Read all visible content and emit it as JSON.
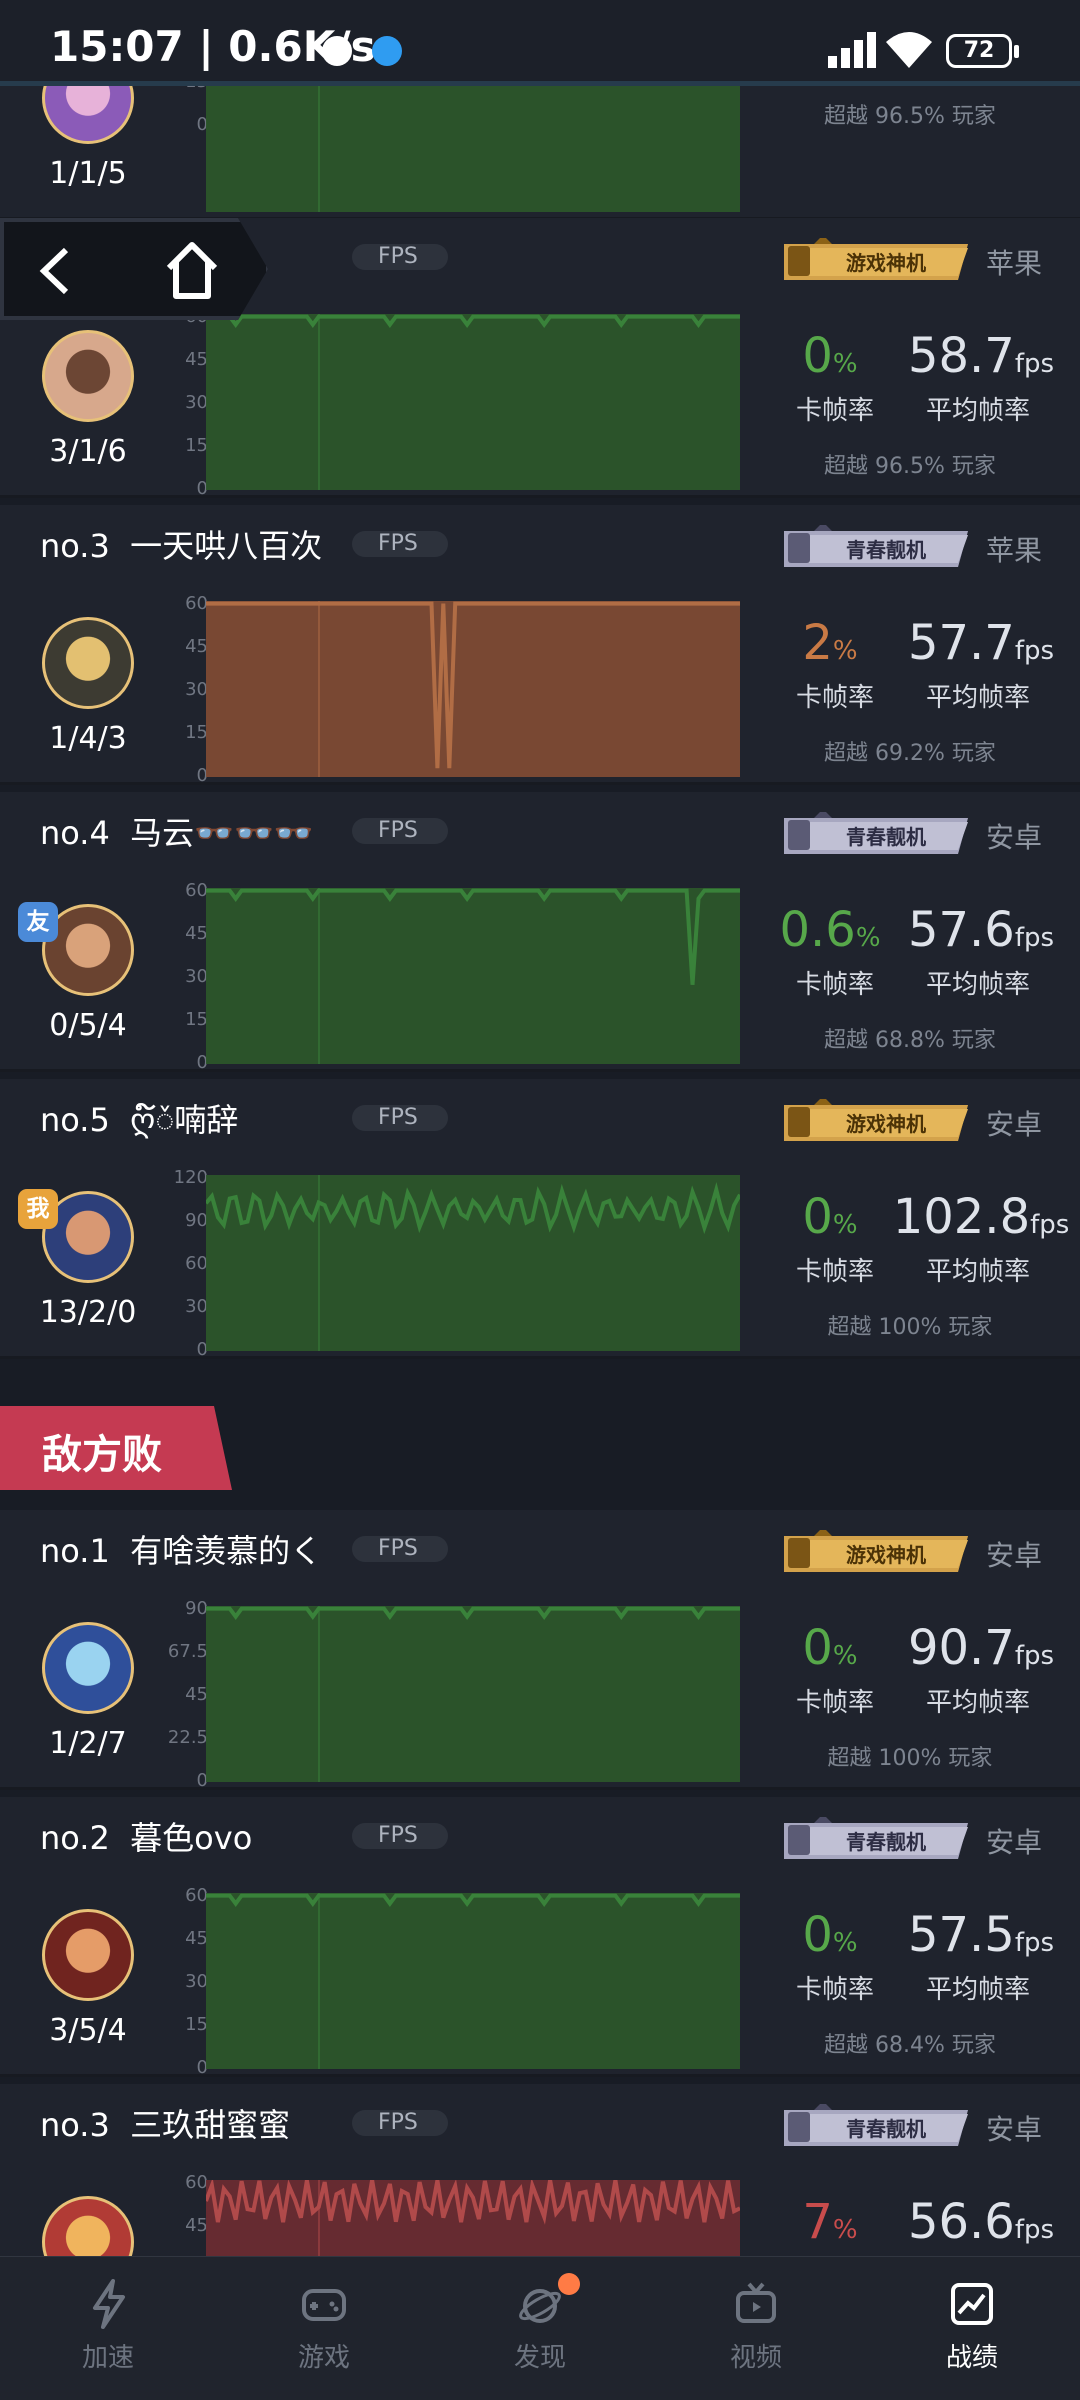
{
  "status_bar": {
    "time": "15:07",
    "speed": "0.6K/s",
    "battery": "72"
  },
  "section_enemy_label": "敌方败",
  "cards": [
    {
      "no": "",
      "name": "",
      "os": "",
      "kda": "1/1/5",
      "stuck": "",
      "avg": "",
      "stuck_label": "卡帧率",
      "avg_label": "平均帧率",
      "beat": "超越 96.5% 玩家",
      "ticks": [
        "30",
        "15",
        "0"
      ],
      "max": 60,
      "color": "#2c562a",
      "line": "#39823a",
      "badge": ""
    },
    {
      "no": "",
      "name": "",
      "os": "苹果",
      "kda": "3/1/6",
      "stuck": "0",
      "avg": "58.7",
      "stuck_label": "卡帧率",
      "avg_label": "平均帧率",
      "beat": "超越 96.5% 玩家",
      "ticks": [
        "60",
        "45",
        "30",
        "15",
        "0"
      ],
      "max": 60,
      "color": "#2c562a",
      "line": "#39823a",
      "badge": "gold"
    },
    {
      "no": "no.3",
      "name": "一天哄八百次",
      "os": "苹果",
      "kda": "1/4/3",
      "stuck": "2",
      "avg": "57.7",
      "stuck_label": "卡帧率",
      "avg_label": "平均帧率",
      "beat": "超越 69.2% 玩家",
      "ticks": [
        "60",
        "45",
        "30",
        "15",
        "0"
      ],
      "max": 60,
      "color": "#7e4b34",
      "line": "#b16d45",
      "badge": "purple"
    },
    {
      "no": "no.4",
      "name": "马云👓👓👓",
      "os": "安卓",
      "kda": "0/5/4",
      "stuck": "0.6",
      "avg": "57.6",
      "stuck_label": "卡帧率",
      "avg_label": "平均帧率",
      "beat": "超越 68.8% 玩家",
      "ticks": [
        "60",
        "45",
        "30",
        "15",
        "0"
      ],
      "max": 60,
      "color": "#2c562a",
      "line": "#39823a",
      "badge": "purple",
      "tag": "友"
    },
    {
      "no": "no.5",
      "name": "ღ໌ᮨ喃辞",
      "os": "安卓",
      "kda": "13/2/0",
      "stuck": "0",
      "avg": "102.8",
      "stuck_label": "卡帧率",
      "avg_label": "平均帧率",
      "beat": "超越 100% 玩家",
      "ticks": [
        "120",
        "90",
        "60",
        "30",
        "0"
      ],
      "max": 120,
      "color": "#2c562a",
      "line": "#39823a",
      "badge": "gold",
      "tag": "我"
    },
    {
      "no": "no.1",
      "name": "有啥羡慕的く",
      "os": "安卓",
      "kda": "1/2/7",
      "stuck": "0",
      "avg": "90.7",
      "stuck_label": "卡帧率",
      "avg_label": "平均帧率",
      "beat": "超越 100% 玩家",
      "ticks": [
        "90",
        "67.5",
        "45",
        "22.5",
        "0"
      ],
      "max": 90,
      "color": "#2c562a",
      "line": "#39823a",
      "badge": "gold"
    },
    {
      "no": "no.2",
      "name": "暮色ovo",
      "os": "安卓",
      "kda": "3/5/4",
      "stuck": "0",
      "avg": "57.5",
      "stuck_label": "卡帧率",
      "avg_label": "平均帧率",
      "beat": "超越 68.4% 玩家",
      "ticks": [
        "60",
        "45",
        "30",
        "15",
        "0"
      ],
      "max": 60,
      "color": "#2c562a",
      "line": "#39823a",
      "badge": "purple"
    },
    {
      "no": "no.3",
      "name": "三玖甜蜜蜜",
      "os": "安卓",
      "kda": "",
      "stuck": "7",
      "avg": "56.6",
      "stuck_label": "卡帧率",
      "avg_label": "平均帧率",
      "beat": "",
      "ticks": [
        "60",
        "45"
      ],
      "max": 60,
      "color": "#6a2c32",
      "line": "#b04a4a",
      "badge": "purple"
    }
  ],
  "badges": {
    "gold": "游戏神机",
    "purple": "青春靓机"
  },
  "fps_tag": "FPS",
  "percent_unit": "%",
  "fps_unit": "fps",
  "nav": {
    "items": [
      "加速",
      "游戏",
      "发现",
      "视频",
      "战绩"
    ],
    "active": "战绩"
  }
}
